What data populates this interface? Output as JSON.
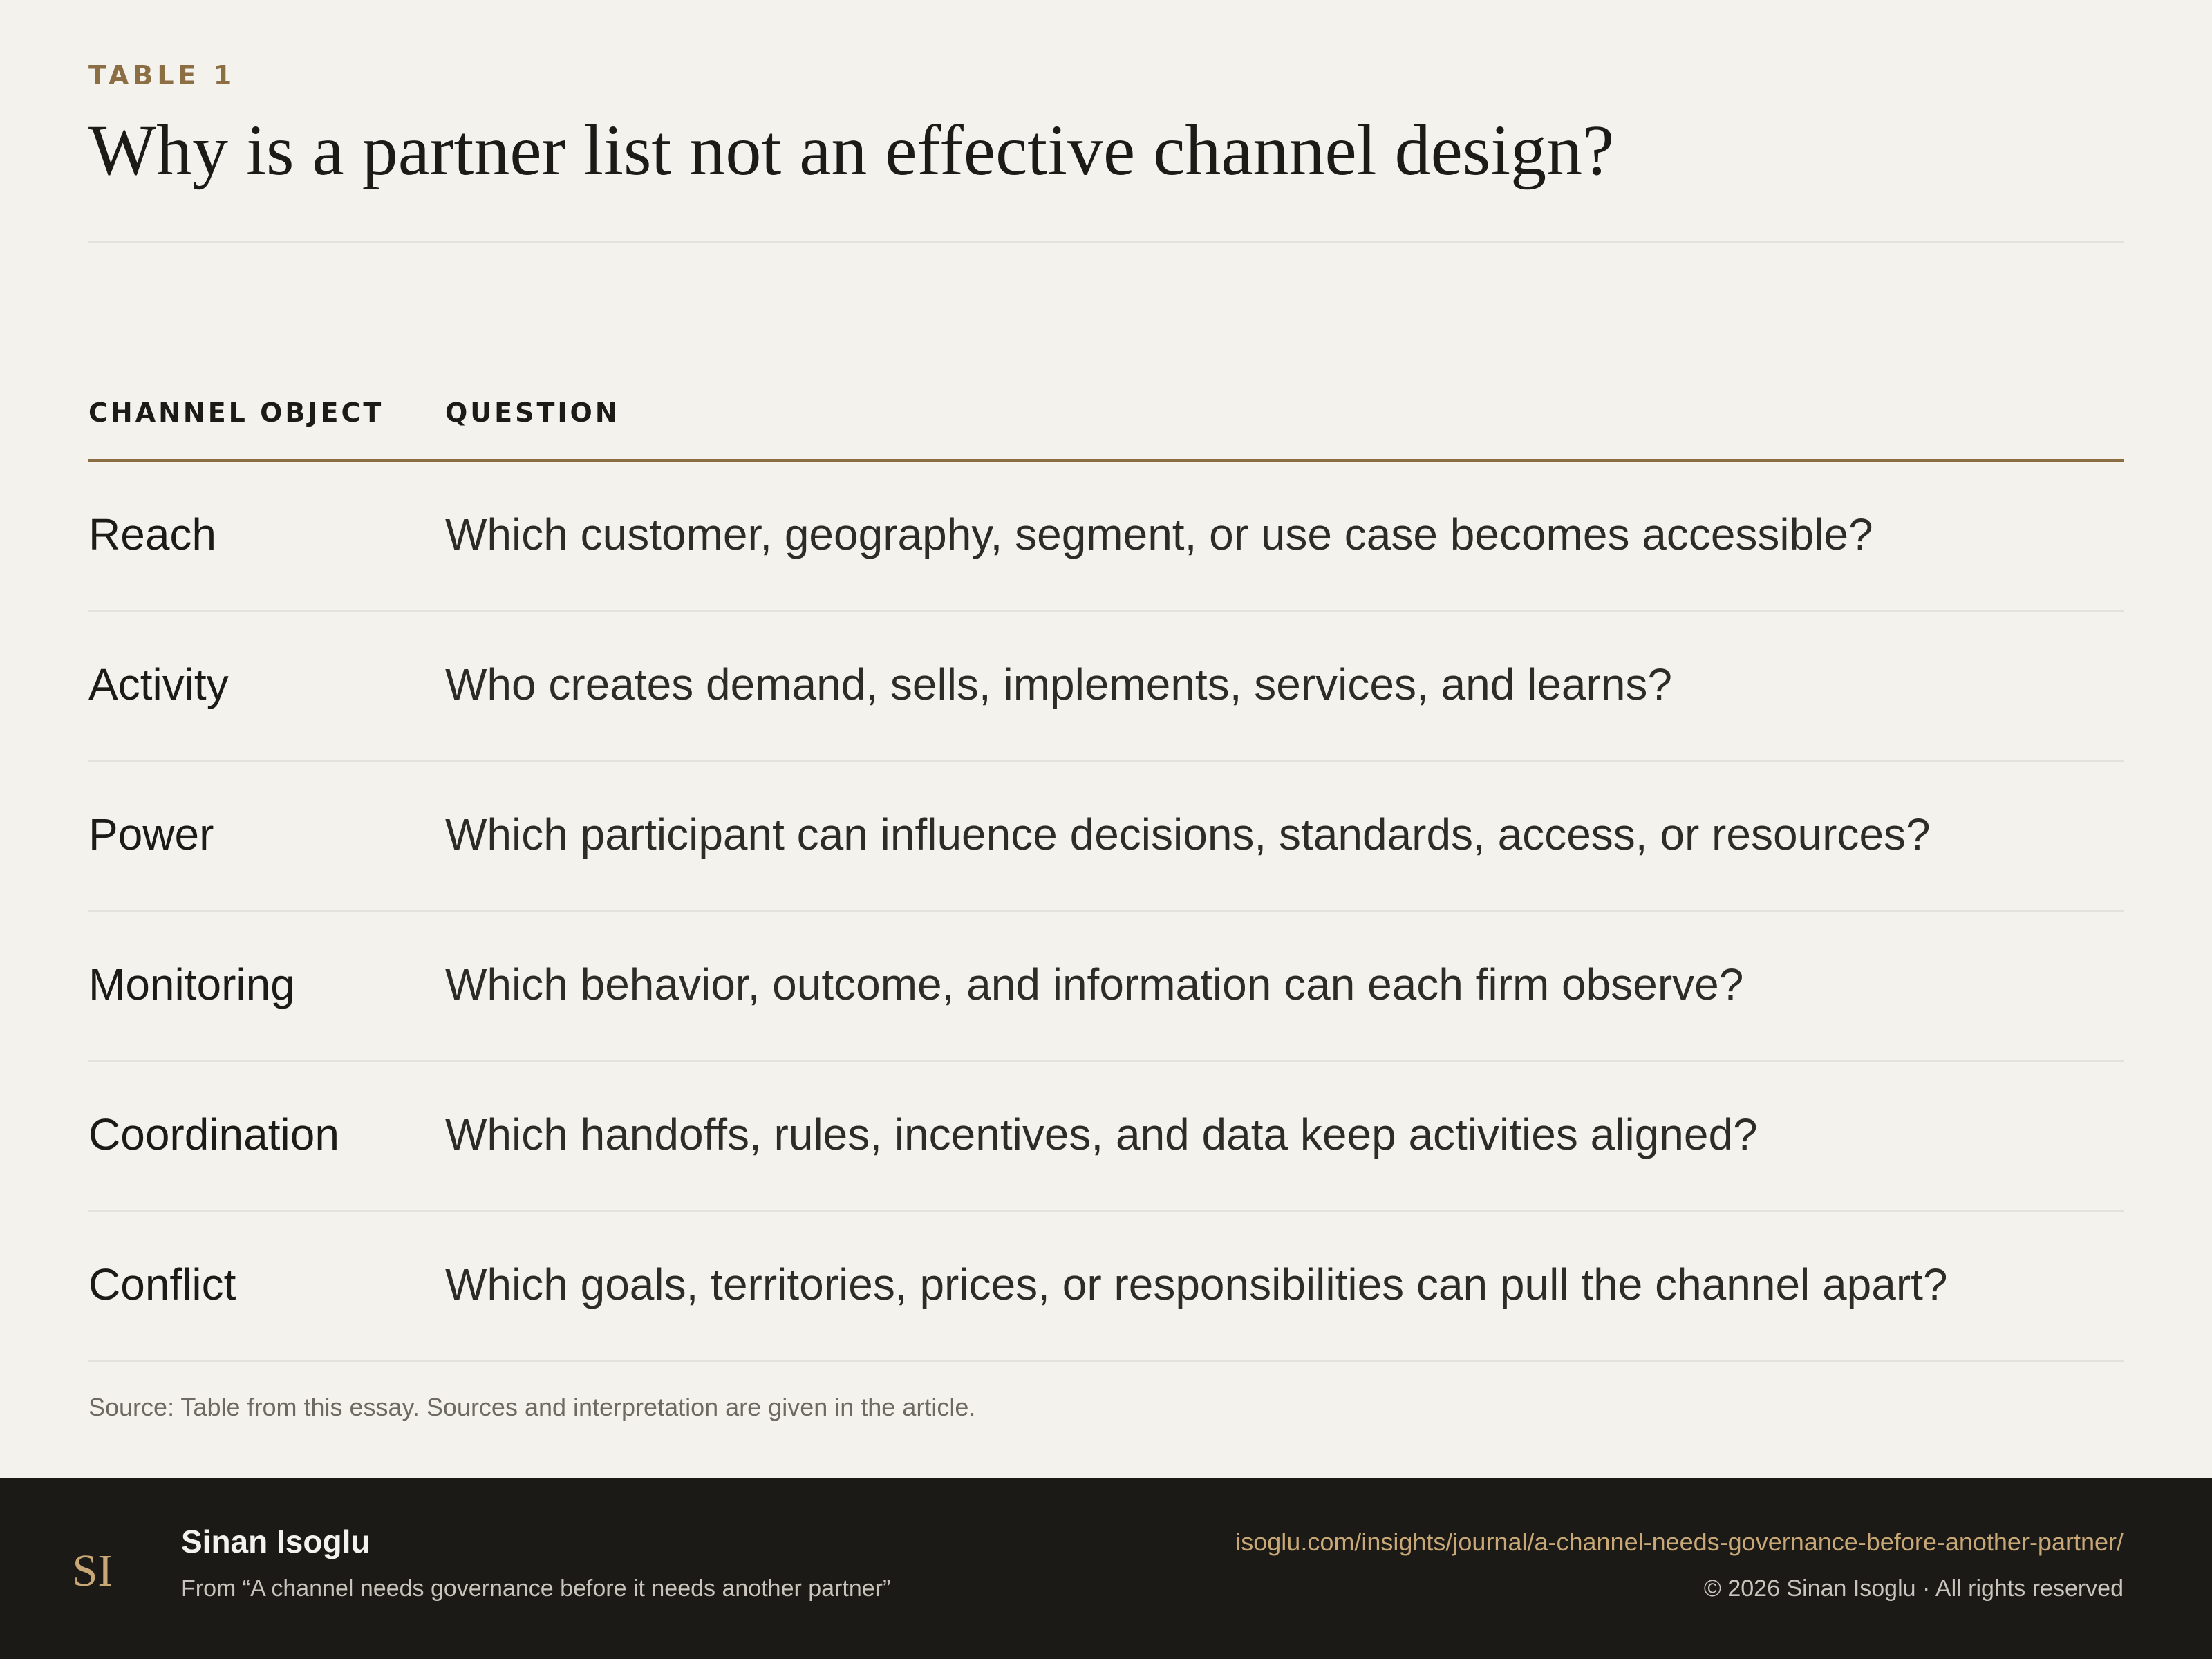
{
  "header": {
    "eyebrow": "TABLE 1",
    "title": "Why is a partner list not an effective channel design?"
  },
  "table": {
    "columns": [
      "CHANNEL OBJECT",
      "QUESTION"
    ],
    "rows": [
      {
        "object": "Reach",
        "question": "Which customer, geography, segment, or use case becomes accessible?"
      },
      {
        "object": "Activity",
        "question": "Who creates demand, sells, implements, services, and learns?"
      },
      {
        "object": "Power",
        "question": "Which participant can influence decisions, standards, access, or resources?"
      },
      {
        "object": "Monitoring",
        "question": "Which behavior, outcome, and information can each firm observe?"
      },
      {
        "object": "Coordination",
        "question": "Which handoffs, rules, incentives, and data keep activities aligned?"
      },
      {
        "object": "Conflict",
        "question": "Which goals, territories, prices, or responsibilities can pull the channel apart?"
      }
    ]
  },
  "source": "Source: Table from this essay. Sources and interpretation are given in the article.",
  "footer": {
    "logo_text": "SI",
    "author": "Sinan Isoglu",
    "from": "From “A channel needs governance before it needs another partner”",
    "url": "isoglu.com/insights/journal/a-channel-needs-governance-before-another-partner/",
    "copyright": "© 2026 Sinan Isoglu · All rights reserved"
  },
  "colors": {
    "background": "#f3f2ed",
    "accent": "#8c6e45",
    "footer_background": "#1c1a17",
    "link": "#c9a877"
  }
}
